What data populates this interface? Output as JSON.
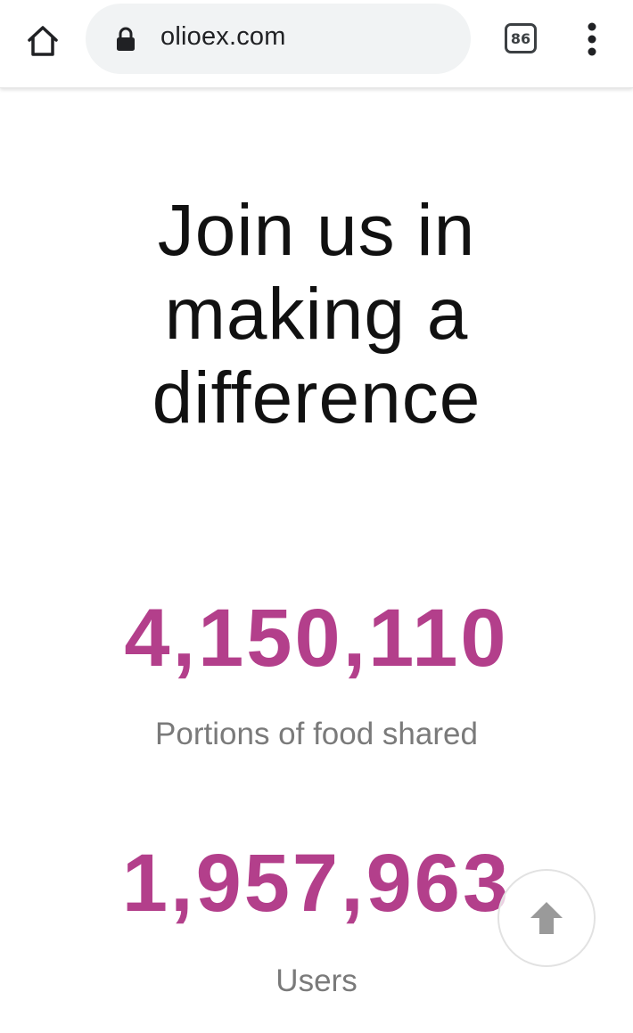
{
  "browser": {
    "url": "olioex.com",
    "tab_count": "86",
    "icons": {
      "home": "home-icon",
      "lock": "lock-icon",
      "menu": "more-vert-icon"
    }
  },
  "main": {
    "headline_lines": [
      "Join us in",
      "making a",
      "difference"
    ],
    "stats": [
      {
        "value": "4,150,110",
        "label": "Portions of food shared"
      },
      {
        "value": "1,957,963",
        "label": "Users"
      }
    ]
  },
  "colors": {
    "accent": "#b33f8b",
    "headline": "#111111",
    "label": "#7a7a7a"
  }
}
